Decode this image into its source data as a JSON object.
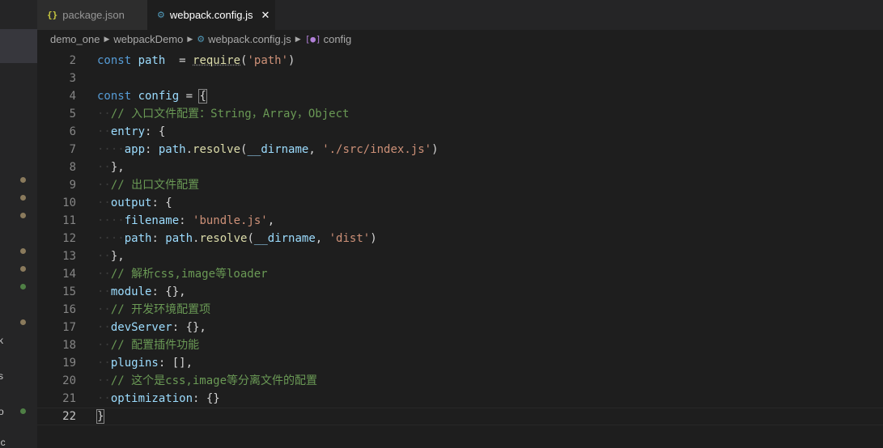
{
  "tabs": [
    {
      "label": "package.json",
      "icon": "{}",
      "active": false
    },
    {
      "label": "webpack.config.js",
      "icon": "⚙",
      "active": true
    }
  ],
  "close_glyph": "✕",
  "breadcrumb": {
    "items": [
      "demo_one",
      "webpackDemo",
      "webpack.config.js",
      "config"
    ],
    "separator": "▶",
    "symbol_icon": "[●]"
  },
  "sidebar": {
    "chars": [
      "k",
      "s",
      "o",
      "ic"
    ],
    "git_dots": [
      {
        "color": "#8a7a5c"
      },
      {
        "color": "#8a7a5c"
      },
      {
        "color": "#8a7a5c"
      },
      {
        "color": "#8a7a5c"
      },
      {
        "color": "#8a7a5c"
      },
      {
        "color": "#4f7f45"
      },
      {
        "color": "#8a7a5c"
      },
      {
        "color": "#4f7f45"
      }
    ]
  },
  "editor": {
    "current_line": 22,
    "lines": [
      {
        "n": "2",
        "tokens": [
          [
            "kw",
            "const "
          ],
          [
            "var",
            "path"
          ],
          [
            "",
            "  = "
          ],
          [
            "fn req",
            "require"
          ],
          [
            "",
            "("
          ],
          [
            "str",
            "'path'"
          ],
          [
            "",
            ")"
          ]
        ]
      },
      {
        "n": "3",
        "tokens": []
      },
      {
        "n": "4",
        "tokens": [
          [
            "kw",
            "const "
          ],
          [
            "var",
            "config"
          ],
          [
            "",
            " = "
          ],
          [
            "bracket-match",
            "{"
          ]
        ]
      },
      {
        "n": "5",
        "tokens": [
          [
            "ws",
            "··"
          ],
          [
            "cm",
            "// 入口文件配置：String，Array，Object"
          ]
        ]
      },
      {
        "n": "6",
        "tokens": [
          [
            "ws",
            "··"
          ],
          [
            "prop",
            "entry"
          ],
          [
            "",
            ": {"
          ]
        ]
      },
      {
        "n": "7",
        "tokens": [
          [
            "ws",
            "····"
          ],
          [
            "prop",
            "app"
          ],
          [
            "",
            ": "
          ],
          [
            "var",
            "path"
          ],
          [
            "",
            "."
          ],
          [
            "fn",
            "resolve"
          ],
          [
            "",
            "("
          ],
          [
            "var",
            "__dirname"
          ],
          [
            "",
            ", "
          ],
          [
            "str",
            "'./src/index.js'"
          ],
          [
            "",
            ")"
          ]
        ]
      },
      {
        "n": "8",
        "tokens": [
          [
            "ws",
            "··"
          ],
          [
            "",
            "},"
          ]
        ]
      },
      {
        "n": "9",
        "tokens": [
          [
            "ws",
            "··"
          ],
          [
            "cm",
            "// 出口文件配置"
          ]
        ]
      },
      {
        "n": "10",
        "tokens": [
          [
            "ws",
            "··"
          ],
          [
            "prop",
            "output"
          ],
          [
            "",
            ": {"
          ]
        ]
      },
      {
        "n": "11",
        "tokens": [
          [
            "ws",
            "····"
          ],
          [
            "prop",
            "filename"
          ],
          [
            "",
            ": "
          ],
          [
            "str",
            "'bundle.js'"
          ],
          [
            "",
            ","
          ]
        ]
      },
      {
        "n": "12",
        "tokens": [
          [
            "ws",
            "····"
          ],
          [
            "prop",
            "path"
          ],
          [
            "",
            ": "
          ],
          [
            "var",
            "path"
          ],
          [
            "",
            "."
          ],
          [
            "fn",
            "resolve"
          ],
          [
            "",
            "("
          ],
          [
            "var",
            "__dirname"
          ],
          [
            "",
            ", "
          ],
          [
            "str",
            "'dist'"
          ],
          [
            "",
            ")"
          ]
        ]
      },
      {
        "n": "13",
        "tokens": [
          [
            "ws",
            "··"
          ],
          [
            "",
            "},"
          ]
        ]
      },
      {
        "n": "14",
        "tokens": [
          [
            "ws",
            "··"
          ],
          [
            "cm",
            "// 解析css,image等loader"
          ]
        ]
      },
      {
        "n": "15",
        "tokens": [
          [
            "ws",
            "··"
          ],
          [
            "prop",
            "module"
          ],
          [
            "",
            ": {},"
          ]
        ]
      },
      {
        "n": "16",
        "tokens": [
          [
            "ws",
            "··"
          ],
          [
            "cm",
            "// 开发环境配置项"
          ]
        ]
      },
      {
        "n": "17",
        "tokens": [
          [
            "ws",
            "··"
          ],
          [
            "prop",
            "devServer"
          ],
          [
            "",
            ": {},"
          ]
        ]
      },
      {
        "n": "18",
        "tokens": [
          [
            "ws",
            "··"
          ],
          [
            "cm",
            "// 配置插件功能"
          ]
        ]
      },
      {
        "n": "19",
        "tokens": [
          [
            "ws",
            "··"
          ],
          [
            "prop",
            "plugins"
          ],
          [
            "",
            ": [],"
          ]
        ]
      },
      {
        "n": "20",
        "tokens": [
          [
            "ws",
            "··"
          ],
          [
            "cm",
            "// 这个是css,image等分离文件的配置"
          ]
        ]
      },
      {
        "n": "21",
        "tokens": [
          [
            "ws",
            "··"
          ],
          [
            "prop",
            "optimization"
          ],
          [
            "",
            ": {}"
          ]
        ]
      },
      {
        "n": "22",
        "tokens": [
          [
            "bracket-match",
            "}"
          ]
        ]
      }
    ]
  }
}
